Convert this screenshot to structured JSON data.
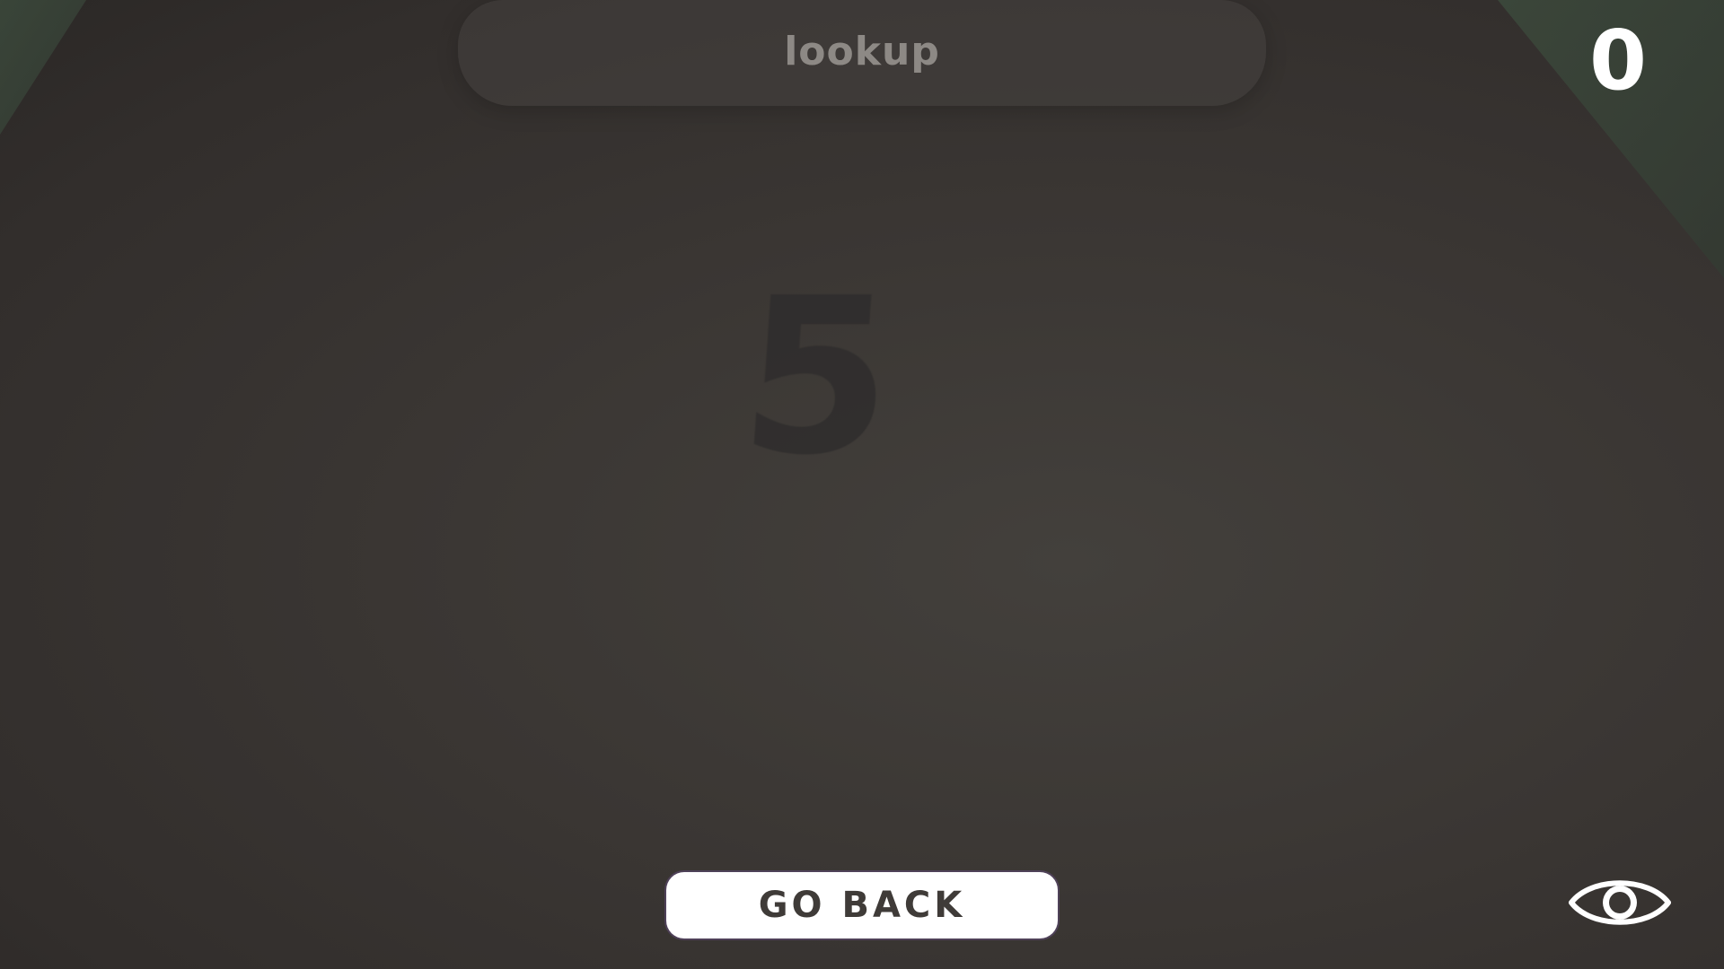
{
  "word_prompt": "lookup",
  "score": "0",
  "countdown": "5",
  "go_back_label": "GO BACK",
  "icons": {
    "view_toggle": "eye-icon"
  },
  "colors": {
    "background": "#3b3734",
    "panel": "#46423f",
    "button": "#ffffff",
    "button_text": "#3f3b38",
    "accent_edge": "#3c4a3c"
  }
}
